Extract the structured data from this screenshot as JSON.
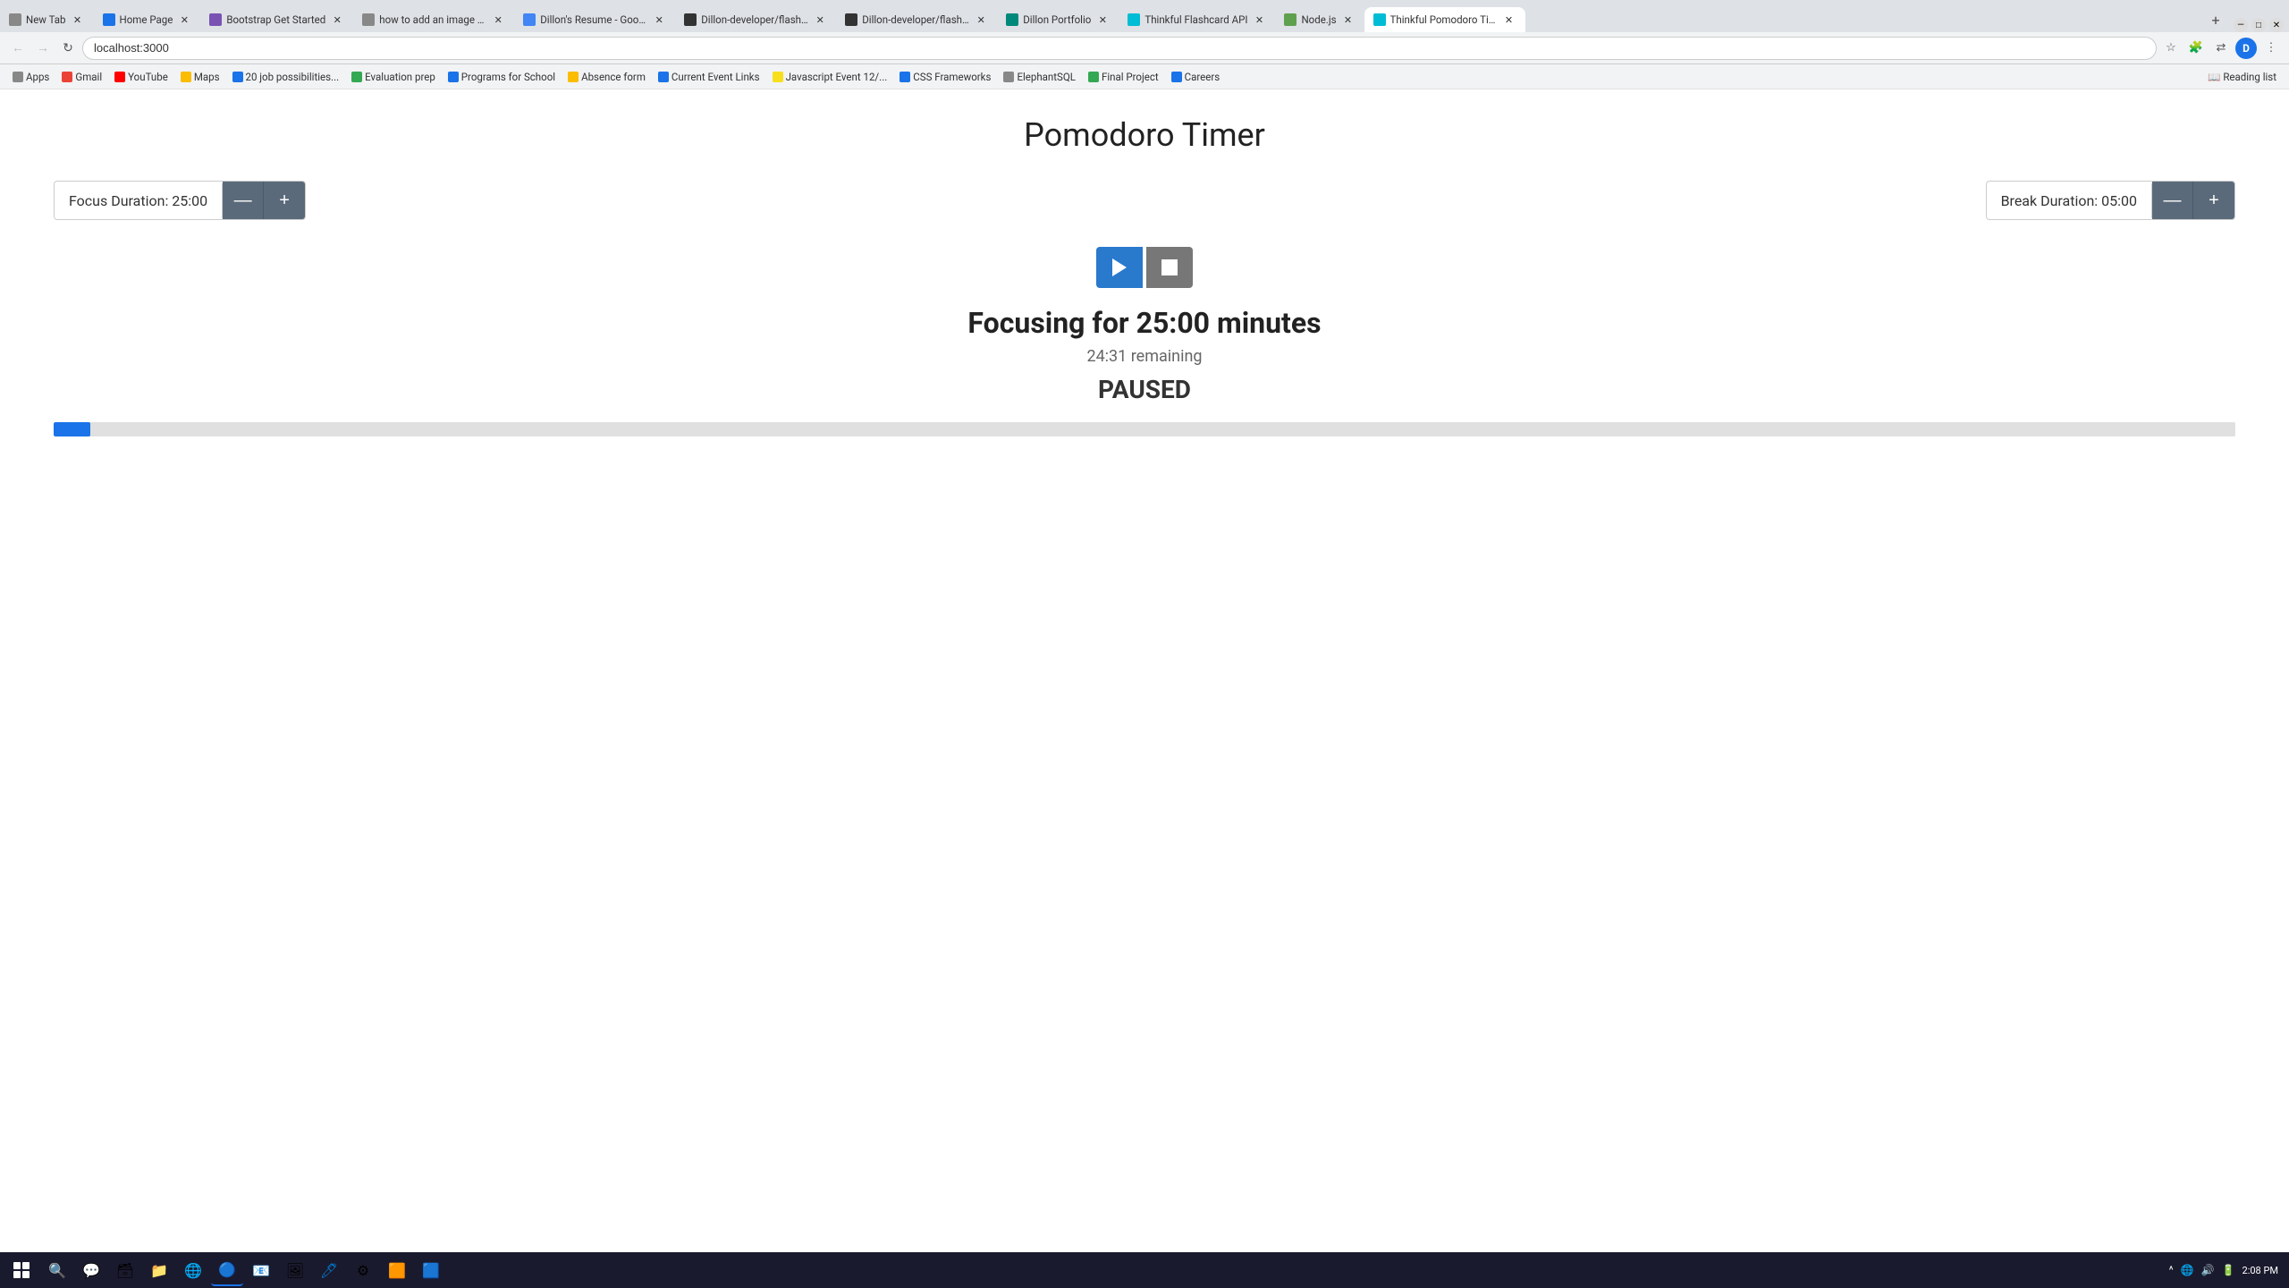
{
  "browser": {
    "address": "localhost:3000",
    "tabs": [
      {
        "label": "New Tab",
        "favicon_color": "#888",
        "active": false,
        "id": "new-tab"
      },
      {
        "label": "Home Page",
        "favicon_color": "#1a73e8",
        "active": false,
        "id": "home-page"
      },
      {
        "label": "Bootstrap Get Started",
        "favicon_color": "#7952b3",
        "active": false,
        "id": "bootstrap"
      },
      {
        "label": "how to add an image file...",
        "favicon_color": "#888",
        "active": false,
        "id": "image-file"
      },
      {
        "label": "Dillon's Resume - Google ...",
        "favicon_color": "#4285f4",
        "active": false,
        "id": "resume"
      },
      {
        "label": "Dillon-developer/flashcar...",
        "favicon_color": "#333",
        "active": false,
        "id": "flashcard1"
      },
      {
        "label": "Dillon-developer/flashcar...",
        "favicon_color": "#333",
        "active": false,
        "id": "flashcard2"
      },
      {
        "label": "Dillon Portfolio",
        "favicon_color": "#00897b",
        "active": false,
        "id": "portfolio"
      },
      {
        "label": "Thinkful Flashcard API",
        "favicon_color": "#00bcd4",
        "active": false,
        "id": "flashcard-api"
      },
      {
        "label": "Node.js",
        "favicon_color": "#5fa04e",
        "active": false,
        "id": "nodejs"
      },
      {
        "label": "Thinkful Pomodoro Timer",
        "favicon_color": "#00bcd4",
        "active": true,
        "id": "pomodoro"
      }
    ],
    "bookmarks": [
      {
        "label": "Apps",
        "favicon_color": "#888"
      },
      {
        "label": "Gmail",
        "favicon_color": "#ea4335"
      },
      {
        "label": "YouTube",
        "favicon_color": "#ff0000"
      },
      {
        "label": "Maps",
        "favicon_color": "#fbbc04"
      },
      {
        "label": "20 job possibilities...",
        "favicon_color": "#1a73e8"
      },
      {
        "label": "Evaluation prep",
        "favicon_color": "#34a853"
      },
      {
        "label": "Programs for School",
        "favicon_color": "#1a73e8"
      },
      {
        "label": "Absence form",
        "favicon_color": "#fbbc04"
      },
      {
        "label": "Current Event Links",
        "favicon_color": "#1a73e8"
      },
      {
        "label": "Javascript Event 12/...",
        "favicon_color": "#f7df1e"
      },
      {
        "label": "CSS Frameworks",
        "favicon_color": "#1a73e8"
      },
      {
        "label": "ElephantSQL",
        "favicon_color": "#888"
      },
      {
        "label": "Final Project",
        "favicon_color": "#34a853"
      },
      {
        "label": "Careers",
        "favicon_color": "#1a73e8"
      }
    ],
    "reading_list": "Reading list"
  },
  "page": {
    "title": "Pomodoro Timer",
    "focus_duration_label": "Focus Duration: 25:00",
    "break_duration_label": "Break Duration: 05:00",
    "decrement_label": "—",
    "increment_label": "+",
    "focus_heading": "Focusing for 25:00 minutes",
    "remaining_text": "24:31 remaining",
    "paused_text": "PAUSED",
    "progress_percent": 1.7
  },
  "taskbar": {
    "time": "2:08 PM",
    "icons": [
      "🔍",
      "🗨",
      "📁",
      "🌐",
      "📧",
      "🖼",
      "📝",
      "⚙",
      "🔧"
    ]
  }
}
